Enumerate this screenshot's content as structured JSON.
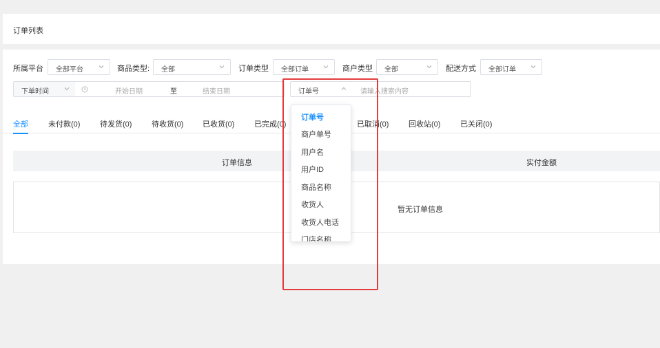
{
  "header": {
    "title": "订单列表"
  },
  "filters": {
    "platform": {
      "label": "所属平台",
      "value": "全部平台"
    },
    "product_type": {
      "label": "商品类型:",
      "value": "全部"
    },
    "order_type": {
      "label": "订单类型",
      "value": "全部订单"
    },
    "merchant_type": {
      "label": "商户类型",
      "value": "全部"
    },
    "delivery": {
      "label": "配送方式",
      "value": "全部订单"
    },
    "time_type": {
      "value": "下单时间"
    },
    "date_range": {
      "start_placeholder": "开始日期",
      "separator": "至",
      "end_placeholder": "结束日期"
    },
    "search_field": {
      "value": "订单号"
    },
    "search": {
      "placeholder": "请输入搜索内容"
    }
  },
  "tabs": [
    {
      "label": "全部",
      "active": true
    },
    {
      "label": "未付款(0)"
    },
    {
      "label": "待发货(0)"
    },
    {
      "label": "待收货(0)"
    },
    {
      "label": "已收货(0)"
    },
    {
      "label": "已完成(0)"
    },
    {
      "label": "已取消(0)"
    },
    {
      "label": "回收站(0)"
    },
    {
      "label": "已关闭(0)"
    }
  ],
  "table": {
    "columns": [
      "订单信息",
      "实付金额"
    ],
    "empty_text": "暂无订单信息"
  },
  "dropdown": {
    "options": [
      "订单号",
      "商户单号",
      "用户名",
      "用户ID",
      "商品名称",
      "收货人",
      "收货人电话",
      "门店名称"
    ],
    "selected": "订单号"
  },
  "colors": {
    "accent": "#1890ff",
    "highlight": "#e33a3a",
    "page_bg": "#f0f0f0"
  },
  "icons": {
    "select_arrow": "chevron-down-icon",
    "select_open": "chevron-up-icon",
    "date": "clock-icon"
  }
}
